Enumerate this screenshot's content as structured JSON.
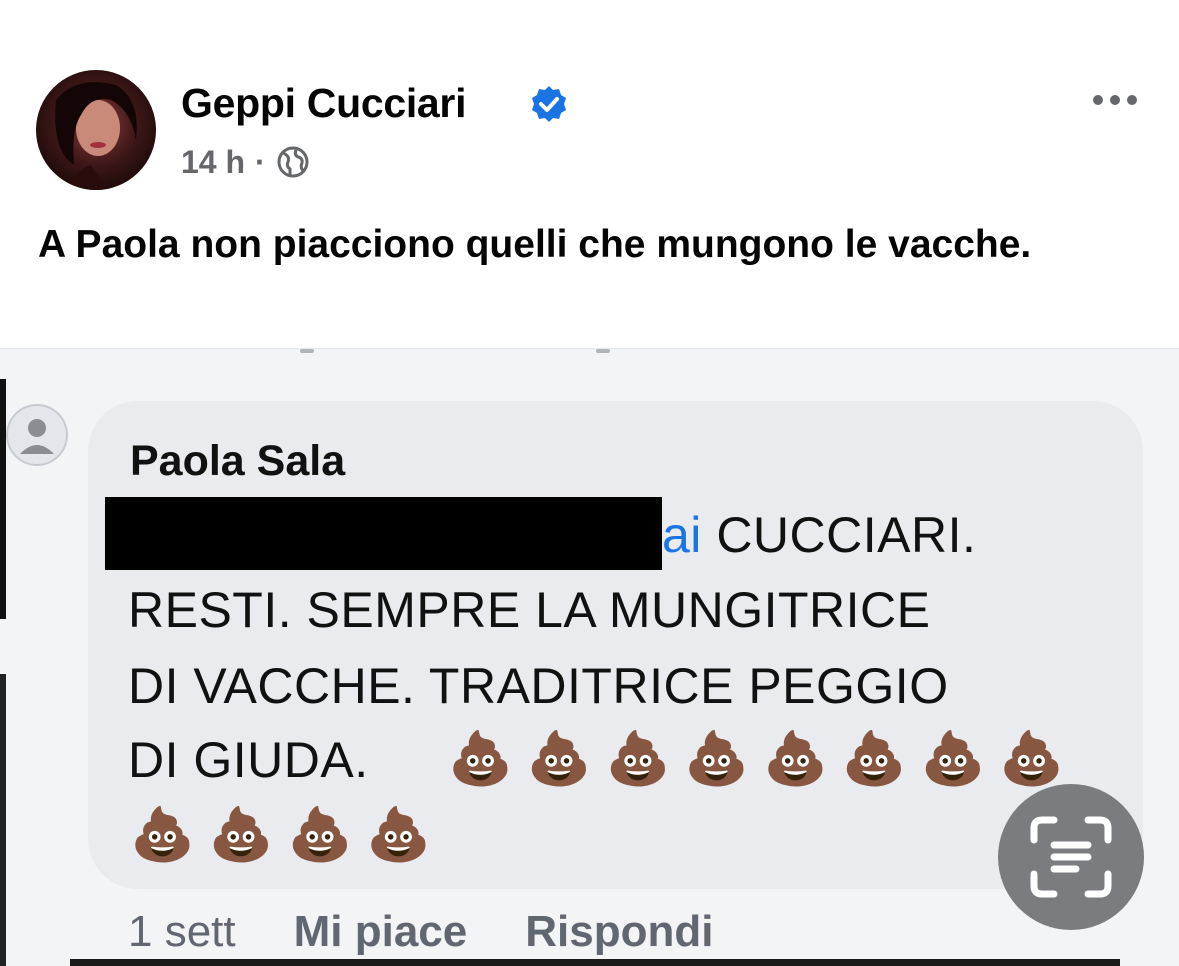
{
  "post": {
    "author": "Geppi Cucciari",
    "verified_icon": "verified-badge-icon",
    "time": "14 h",
    "separator": "·",
    "audience_icon": "globe-icon",
    "more_icon": "more-horizontal-icon",
    "text": "A Paola non piacciono quelli che mungono le vacche."
  },
  "image": {
    "comment": {
      "name": "Paola Sala",
      "line1_visible": "ai",
      "line1_rest": " CUCCIARI.",
      "line2": "RESTI.  SEMPRE  LA MUNGITRICE",
      "line3": "DI VACCHE. TRADITRICE PEGGIO",
      "line4": "DI GIUDA.",
      "emoji_row1": "💩💩💩💩💩💩💩💩",
      "emoji_row2": "💩💩💩💩",
      "redacted": true
    },
    "actions": {
      "time": "1 sett",
      "like": "Mi piace",
      "reply": "Rispondi"
    },
    "lens_icon": "text-scan-icon"
  },
  "colors": {
    "accent_blue": "#1b74e4",
    "secondary_text": "#65676b",
    "bubble_bg": "#e9ebee"
  }
}
